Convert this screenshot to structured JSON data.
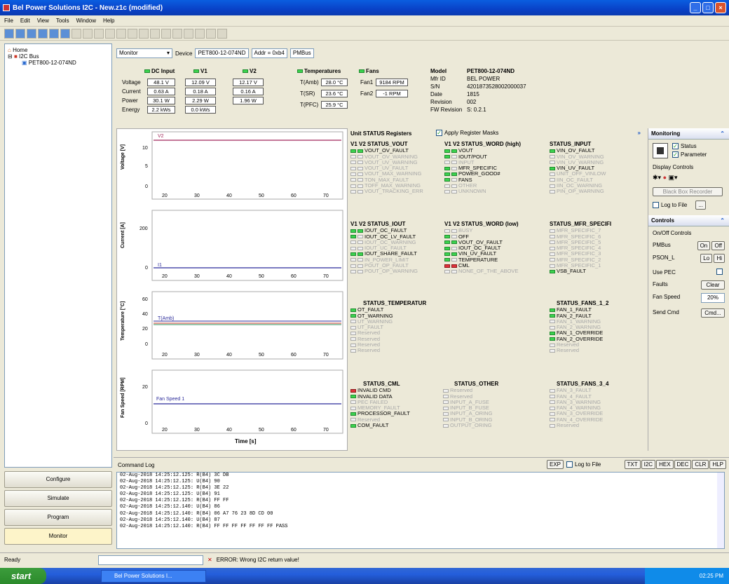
{
  "window": {
    "title": "Bel Power Solutions I2C - New.z1c (modified)"
  },
  "menu": [
    "File",
    "Edit",
    "View",
    "Tools",
    "Window",
    "Help"
  ],
  "tree": {
    "home": "Home",
    "bus": "I2C Bus",
    "device": "PET800-12-074ND"
  },
  "nav": {
    "configure": "Configure",
    "simulate": "Simulate",
    "program": "Program",
    "monitor": "Monitor"
  },
  "devbar": {
    "mode": "Monitor",
    "device_label": "Device",
    "device": "PET800-12-074ND",
    "addr": "Addr = 0xb4",
    "proto": "PMBus"
  },
  "measure": {
    "dc_input": "DC Input",
    "v1": "V1",
    "v2": "V2",
    "temps": "Temperatures",
    "fans": "Fans",
    "row_labels": [
      "Voltage",
      "Current",
      "Power",
      "Energy"
    ],
    "dc_values": [
      "48.1 V",
      "0.63 A",
      "30.1 W",
      "2.2 kWs"
    ],
    "v1_values": [
      "12.09 V",
      "0.18 A",
      "2.29 W",
      "0.0 kWs"
    ],
    "v2_values": [
      "12.17 V",
      "0.16 A",
      "1.96 W"
    ],
    "temp_labels": [
      "T(Amb)",
      "T(SR)",
      "T(PFC)"
    ],
    "temp_values": [
      "28.0 °C",
      "23.6 °C",
      "25.9 °C"
    ],
    "fan_labels": [
      "Fan1",
      "Fan2"
    ],
    "fan_values": [
      "9184 RPM",
      "-1 RPM"
    ],
    "info_labels": [
      "Model",
      "Mfr ID",
      "S/N",
      "Date",
      "Revision",
      "FW Revision"
    ],
    "info_values": [
      "PET800-12-074ND",
      "BEL POWER",
      "4201873528002000037",
      "1815",
      "002",
      "S: 0.2.1"
    ]
  },
  "charts": {
    "xlabel": "Time [s]",
    "xticks": [
      "20",
      "30",
      "40",
      "50",
      "60",
      "70"
    ],
    "panels": [
      {
        "ylabel": "Voltage [V]",
        "yticks": [
          "10",
          "5",
          "0"
        ],
        "series": "V2"
      },
      {
        "ylabel": "Current [A]",
        "yticks": [
          "200",
          "0"
        ],
        "series": "I1"
      },
      {
        "ylabel": "Temperature [°C]",
        "yticks": [
          "60",
          "40",
          "20",
          "0"
        ],
        "series": "T(Amb)"
      },
      {
        "ylabel": "Fan Speed [RPM]",
        "yticks": [
          "20",
          "0"
        ],
        "series": "Fan Speed 1"
      }
    ]
  },
  "status": {
    "title": "Unit STATUS Registers",
    "apply_masks": "Apply Register Masks",
    "cols": [
      {
        "title": "V1 V2 STATUS_VOUT",
        "items": [
          [
            "VOUT_OV_FAULT",
            1
          ],
          [
            "VOUT_OV_WARNING",
            0
          ],
          [
            "VOUT_UV_WARNING",
            0
          ],
          [
            "VOUT_UV_FAULT",
            0
          ],
          [
            "VOUT_MAX_WARNING",
            0
          ],
          [
            "TON_MAX_FAULT",
            0
          ],
          [
            "TOFF_MAX_WARNING",
            0
          ],
          [
            "VOUT_TRACKING_ERR",
            0
          ]
        ]
      },
      {
        "title": "V1 V2 STATUS_WORD (high)",
        "items": [
          [
            "VOUT",
            1
          ],
          [
            "IOUT/POUT",
            1
          ],
          [
            "INPUT",
            0
          ],
          [
            "MFR_SPECIFIC",
            1
          ],
          [
            "POWER_GOOD#",
            1
          ],
          [
            "FANS",
            1
          ],
          [
            "OTHER",
            0
          ],
          [
            "UNKNOWN",
            0
          ]
        ]
      },
      {
        "title": "STATUS_INPUT",
        "items": [
          [
            "VIN_OV_FAULT",
            1
          ],
          [
            "VIN_OV_WARNING",
            0
          ],
          [
            "VIN_UV_WARNING",
            0
          ],
          [
            "VIN_UV_FAULT",
            1
          ],
          [
            "UNIT_OFF_VINLOW",
            0
          ],
          [
            "IIN_OC_FAULT",
            0
          ],
          [
            "IIN_OC_WARNING",
            0
          ],
          [
            "PIN_OP_WARNING",
            0
          ]
        ]
      },
      {
        "title": "V1 V2 STATUS_IOUT",
        "items": [
          [
            "IOUT_OC_FAULT",
            1
          ],
          [
            "IOUT_OC_LV_FAULT",
            1
          ],
          [
            "IOUT_OC_WARNING",
            0
          ],
          [
            "IOUT_UC_FAULT",
            0
          ],
          [
            "IOUT_SHARE_FAULT",
            1
          ],
          [
            "IN_POWER_LIMIT",
            0
          ],
          [
            "POUT_OP_FAULT",
            0
          ],
          [
            "POUT_OP_WARNING",
            0
          ]
        ]
      },
      {
        "title": "V1 V2 STATUS_WORD (low)",
        "items": [
          [
            "BUSY",
            0
          ],
          [
            "OFF",
            1
          ],
          [
            "VOUT_OV_FAULT",
            1
          ],
          [
            "IOUT_OC_FAULT",
            1
          ],
          [
            "VIN_UV_FAULT",
            1
          ],
          [
            "TEMPERATURE",
            1
          ],
          [
            "CML",
            2
          ],
          [
            "NONE_OF_THE_ABOVE",
            0
          ]
        ]
      },
      {
        "title": "STATUS_MFR_SPECIFI",
        "items": [
          [
            "MFR_SPECIFIC_7",
            0
          ],
          [
            "MFR_SPECIFIC_6",
            0
          ],
          [
            "MFR_SPECIFIC_5",
            0
          ],
          [
            "MFR_SPECIFIC_4",
            0
          ],
          [
            "MFR_SPECIFIC_3",
            0
          ],
          [
            "MFR_SPECIFIC_2",
            0
          ],
          [
            "MFR_SPECIFIC_1",
            0
          ],
          [
            "VSB_FAULT",
            1
          ]
        ]
      },
      {
        "title": "STATUS_TEMPERATUR",
        "items": [
          [
            "OT_FAULT",
            1
          ],
          [
            "OT_WARNING",
            1
          ],
          [
            "UT_WARNING",
            0
          ],
          [
            "UT_FAULT",
            0
          ],
          [
            "Reserved",
            0
          ],
          [
            "Reserved",
            0
          ],
          [
            "Reserved",
            0
          ],
          [
            "Reserved",
            0
          ]
        ]
      },
      {
        "title": "STATUS_FANS_1_2",
        "items": [
          [
            "FAN_1_FAULT",
            1
          ],
          [
            "FAN_2_FAULT",
            1
          ],
          [
            "FAN_1_WARNING",
            0
          ],
          [
            "FAN_2_WARNING",
            0
          ],
          [
            "FAN_1_OVERRIDE",
            1
          ],
          [
            "FAN_2_OVERRIDE",
            1
          ],
          [
            "Reserved",
            0
          ],
          [
            "Reserved",
            0
          ]
        ]
      },
      {
        "title": "STATUS_CML",
        "items": [
          [
            "INVALID CMD",
            2
          ],
          [
            "INVALID DATA",
            1
          ],
          [
            "PEC FAILED",
            0
          ],
          [
            "MEMORY_FAULT",
            0
          ],
          [
            "PROCESSOR_FAULT",
            1
          ],
          [
            "Reserved",
            0
          ],
          [
            "COM_FAULT",
            1
          ]
        ]
      },
      {
        "title": "STATUS_OTHER",
        "items": [
          [
            "Reserved",
            0
          ],
          [
            "Reserved",
            0
          ],
          [
            "INPUT_A_FUSE",
            0
          ],
          [
            "INPUT_B_FUSE",
            0
          ],
          [
            "INPUT_A_ORING",
            0
          ],
          [
            "INPUT_B_ORING",
            0
          ],
          [
            "OUTPUT_ORING",
            0
          ]
        ]
      },
      {
        "title": "STATUS_FANS_3_4",
        "items": [
          [
            "FAN_3_FAULT",
            0
          ],
          [
            "FAN_4_FAULT",
            0
          ],
          [
            "FAN_3_WARNING",
            0
          ],
          [
            "FAN_4_WARNING",
            0
          ],
          [
            "FAN_3_OVERRIDE",
            0
          ],
          [
            "FAN_4_OVERRIDE",
            0
          ],
          [
            "Reserved",
            0
          ]
        ]
      }
    ]
  },
  "monitoring": {
    "title": "Monitoring",
    "status": "Status",
    "parameter": "Parameter",
    "display_controls": "Display Controls",
    "blackbox": "Black Box Recorder",
    "log_to_file": "Log to File"
  },
  "controls": {
    "title": "Controls",
    "onoff": "On/Off Controls",
    "pmbus": "PMBus",
    "on": "On",
    "off": "Off",
    "pson": "PSON_L",
    "lo": "Lo",
    "hi": "Hi",
    "use_pec": "Use PEC",
    "faults": "Faults",
    "clear": "Clear",
    "fan_speed": "Fan Speed",
    "fan_value": "20%",
    "send_cmd": "Send Cmd",
    "cmd_btn": "Cmd..."
  },
  "cmdlog": {
    "title": "Command Log",
    "exp": "EXP",
    "log_to_file": "Log to File",
    "buttons": [
      "TXT",
      "I2C",
      "HEX",
      "DEC",
      "CLR",
      "HLP"
    ],
    "lines": [
      "02-Aug-2018 14:25:12.125: R(B4) 3C DB",
      "02-Aug-2018 14:25:12.125: U(B4) 90",
      "02-Aug-2018 14:25:12.125: R(B4) 3E 22",
      "02-Aug-2018 14:25:12.125: U(B4) 91",
      "02-Aug-2018 14:25:12.125: R(B4) FF FF",
      "02-Aug-2018 14:25:12.140: U(B4) 86",
      "02-Aug-2018 14:25:12.140: R(B4) 06 A7 76 23 8D CD 00",
      "02-Aug-2018 14:25:12.140: U(B4) 87",
      "02-Aug-2018 14:25:12.140: R(B4) FF FF FF FF FF FF FF    PASS"
    ]
  },
  "statusbar": {
    "ready": "Ready",
    "error": "ERROR: Wrong I2C return value!"
  },
  "taskbar": {
    "start": "start",
    "task": "Bel Power Solutions I...",
    "clock": "02:25 PM"
  }
}
